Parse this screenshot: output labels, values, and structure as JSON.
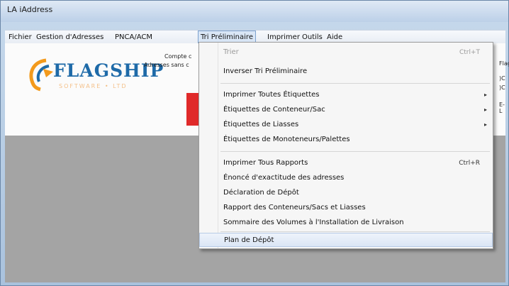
{
  "window": {
    "title": "LA iAddress"
  },
  "menubar": {
    "items": [
      {
        "label": "Fichier"
      },
      {
        "label": "Gestion d'Adresses"
      },
      {
        "label": "PNCA/ACM"
      },
      {
        "label": "Tri Préliminaire"
      },
      {
        "label": "Imprimer"
      },
      {
        "label": "Outils"
      },
      {
        "label": "Aide"
      }
    ]
  },
  "panel": {
    "logo_text": "FLAGSHIP",
    "logo_sub": "SOFTWARE • LTD",
    "label_1": "Compte c",
    "label_2": "Adresses sans c",
    "right_1": "Flag",
    "right_2": ")C",
    "right_3": ")C",
    "right_4": "E-L"
  },
  "dropdown": {
    "items": [
      {
        "label": "Trier",
        "shortcut": "Ctrl+T",
        "disabled": true
      },
      {
        "label": "Inverser Tri Préliminaire"
      },
      {
        "label": "Imprimer Toutes Étiquettes",
        "submenu": "▸"
      },
      {
        "label": "Étiquettes de Conteneur/Sac",
        "submenu": "▸"
      },
      {
        "label": "Étiquettes de Liasses",
        "submenu": "▸"
      },
      {
        "label": "Étiquettes de Monoteneurs/Palettes"
      },
      {
        "label": "Imprimer Tous Rapports",
        "shortcut": "Ctrl+R"
      },
      {
        "label": "Énoncé d'exactitude des adresses"
      },
      {
        "label": "Déclaration de Dépôt"
      },
      {
        "label": "Rapport des Conteneurs/Sacs et Liasses"
      },
      {
        "label": "Sommaire des Volumes à l'Installation de Livraison"
      },
      {
        "label": "Plan de Dépôt"
      }
    ]
  },
  "colors": {
    "accent": "#1e6aa8",
    "logo_orange": "#f39a1c",
    "red": "#e02a2a"
  }
}
